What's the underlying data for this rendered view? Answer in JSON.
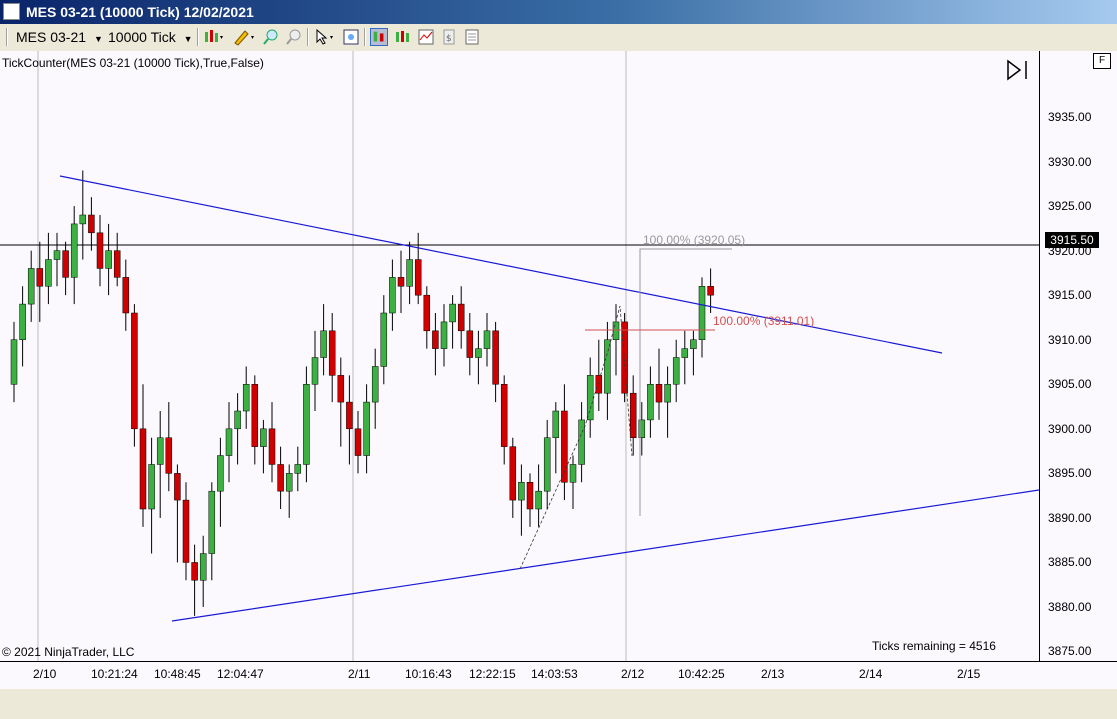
{
  "window": {
    "title": "MES 03-21 (10000 Tick)  12/02/2021"
  },
  "toolbar": {
    "instrument": "MES 03-21",
    "interval": "10000 Tick"
  },
  "chart": {
    "indicator_label": "TickCounter(MES  03-21  (10000  Tick),True,False)",
    "copyright": "© 2021 NinjaTrader, LLC",
    "ticks_remaining": "Ticks remaining = 4516",
    "current_price": "3915.50",
    "fib_upper": "100.00% (3920.05)",
    "fib_lower": "100.00% (3911.01)",
    "f_button": "F",
    "up_color": "#3cb043",
    "down_color": "#d00000",
    "trendline_color": "#1a1ad6"
  },
  "y_axis": [
    "3935.00",
    "3930.00",
    "3925.00",
    "3920.00",
    "3915.00",
    "3910.00",
    "3905.00",
    "3900.00",
    "3895.00",
    "3890.00",
    "3885.00",
    "3880.00",
    "3875.00"
  ],
  "x_axis": [
    "2/10",
    "10:21:24",
    "10:48:45",
    "12:04:47",
    "2/11",
    "10:16:43",
    "12:22:15",
    "14:03:53",
    "2/12",
    "10:42:25",
    "2/13",
    "2/14",
    "2/15"
  ],
  "chart_data": {
    "type": "candlestick",
    "ylim": [
      3874,
      3940
    ],
    "candles": [
      [
        3905,
        3912,
        3903,
        3910
      ],
      [
        3910,
        3916,
        3907,
        3914
      ],
      [
        3914,
        3920,
        3912,
        3918
      ],
      [
        3918,
        3921,
        3912,
        3916
      ],
      [
        3916,
        3922,
        3914,
        3919
      ],
      [
        3919,
        3922,
        3916,
        3920
      ],
      [
        3920,
        3921,
        3915,
        3917
      ],
      [
        3917,
        3925,
        3914,
        3923
      ],
      [
        3923,
        3929,
        3919,
        3924
      ],
      [
        3924,
        3926,
        3920,
        3922
      ],
      [
        3922,
        3924,
        3916,
        3918
      ],
      [
        3918,
        3923,
        3915,
        3920
      ],
      [
        3920,
        3922,
        3916,
        3917
      ],
      [
        3917,
        3919,
        3911,
        3913
      ],
      [
        3913,
        3914,
        3898,
        3900
      ],
      [
        3900,
        3905,
        3889,
        3891
      ],
      [
        3891,
        3899,
        3886,
        3896
      ],
      [
        3896,
        3902,
        3890,
        3899
      ],
      [
        3899,
        3903,
        3893,
        3895
      ],
      [
        3895,
        3896,
        3885,
        3892
      ],
      [
        3892,
        3894,
        3883,
        3885
      ],
      [
        3885,
        3887,
        3879,
        3883
      ],
      [
        3883,
        3888,
        3880,
        3886
      ],
      [
        3886,
        3894,
        3883,
        3893
      ],
      [
        3893,
        3899,
        3889,
        3897
      ],
      [
        3897,
        3903,
        3894,
        3900
      ],
      [
        3900,
        3904,
        3896,
        3902
      ],
      [
        3902,
        3907,
        3900,
        3905
      ],
      [
        3905,
        3906,
        3896,
        3898
      ],
      [
        3898,
        3901,
        3895,
        3900
      ],
      [
        3900,
        3903,
        3894,
        3896
      ],
      [
        3896,
        3898,
        3891,
        3893
      ],
      [
        3893,
        3896,
        3890,
        3895
      ],
      [
        3895,
        3898,
        3893,
        3896
      ],
      [
        3896,
        3907,
        3894,
        3905
      ],
      [
        3905,
        3911,
        3902,
        3908
      ],
      [
        3908,
        3914,
        3906,
        3911
      ],
      [
        3911,
        3913,
        3903,
        3906
      ],
      [
        3906,
        3908,
        3898,
        3903
      ],
      [
        3903,
        3906,
        3896,
        3900
      ],
      [
        3900,
        3902,
        3895,
        3897
      ],
      [
        3897,
        3905,
        3895,
        3903
      ],
      [
        3903,
        3909,
        3900,
        3907
      ],
      [
        3907,
        3915,
        3905,
        3913
      ],
      [
        3913,
        3919,
        3911,
        3917
      ],
      [
        3917,
        3920,
        3913,
        3916
      ],
      [
        3916,
        3921,
        3914,
        3919
      ],
      [
        3919,
        3922,
        3914,
        3915
      ],
      [
        3915,
        3916,
        3909,
        3911
      ],
      [
        3911,
        3913,
        3906,
        3909
      ],
      [
        3909,
        3914,
        3907,
        3912
      ],
      [
        3912,
        3915,
        3909,
        3914
      ],
      [
        3914,
        3916,
        3909,
        3911
      ],
      [
        3911,
        3913,
        3906,
        3908
      ],
      [
        3908,
        3911,
        3905,
        3909
      ],
      [
        3909,
        3913,
        3907,
        3911
      ],
      [
        3911,
        3912,
        3903,
        3905
      ],
      [
        3905,
        3906,
        3896,
        3898
      ],
      [
        3898,
        3899,
        3890,
        3892
      ],
      [
        3892,
        3896,
        3888,
        3894
      ],
      [
        3894,
        3895,
        3889,
        3891
      ],
      [
        3891,
        3896,
        3889,
        3893
      ],
      [
        3893,
        3901,
        3891,
        3899
      ],
      [
        3899,
        3903,
        3895,
        3902
      ],
      [
        3902,
        3905,
        3892,
        3894
      ],
      [
        3894,
        3897,
        3891,
        3896
      ],
      [
        3896,
        3903,
        3894,
        3901
      ],
      [
        3901,
        3908,
        3899,
        3906
      ],
      [
        3906,
        3910,
        3902,
        3904
      ],
      [
        3904,
        3912,
        3901,
        3910
      ],
      [
        3910,
        3914,
        3906,
        3912
      ],
      [
        3912,
        3913,
        3903,
        3904
      ],
      [
        3904,
        3906,
        3897,
        3899
      ],
      [
        3899,
        3903,
        3897,
        3901
      ],
      [
        3901,
        3907,
        3899,
        3905
      ],
      [
        3905,
        3909,
        3901,
        3903
      ],
      [
        3903,
        3907,
        3899,
        3905
      ],
      [
        3905,
        3910,
        3903,
        3908
      ],
      [
        3908,
        3911,
        3905,
        3909
      ],
      [
        3909,
        3911,
        3906,
        3910
      ],
      [
        3910,
        3917,
        3908,
        3916
      ],
      [
        3916,
        3918,
        3913,
        3915
      ]
    ]
  }
}
